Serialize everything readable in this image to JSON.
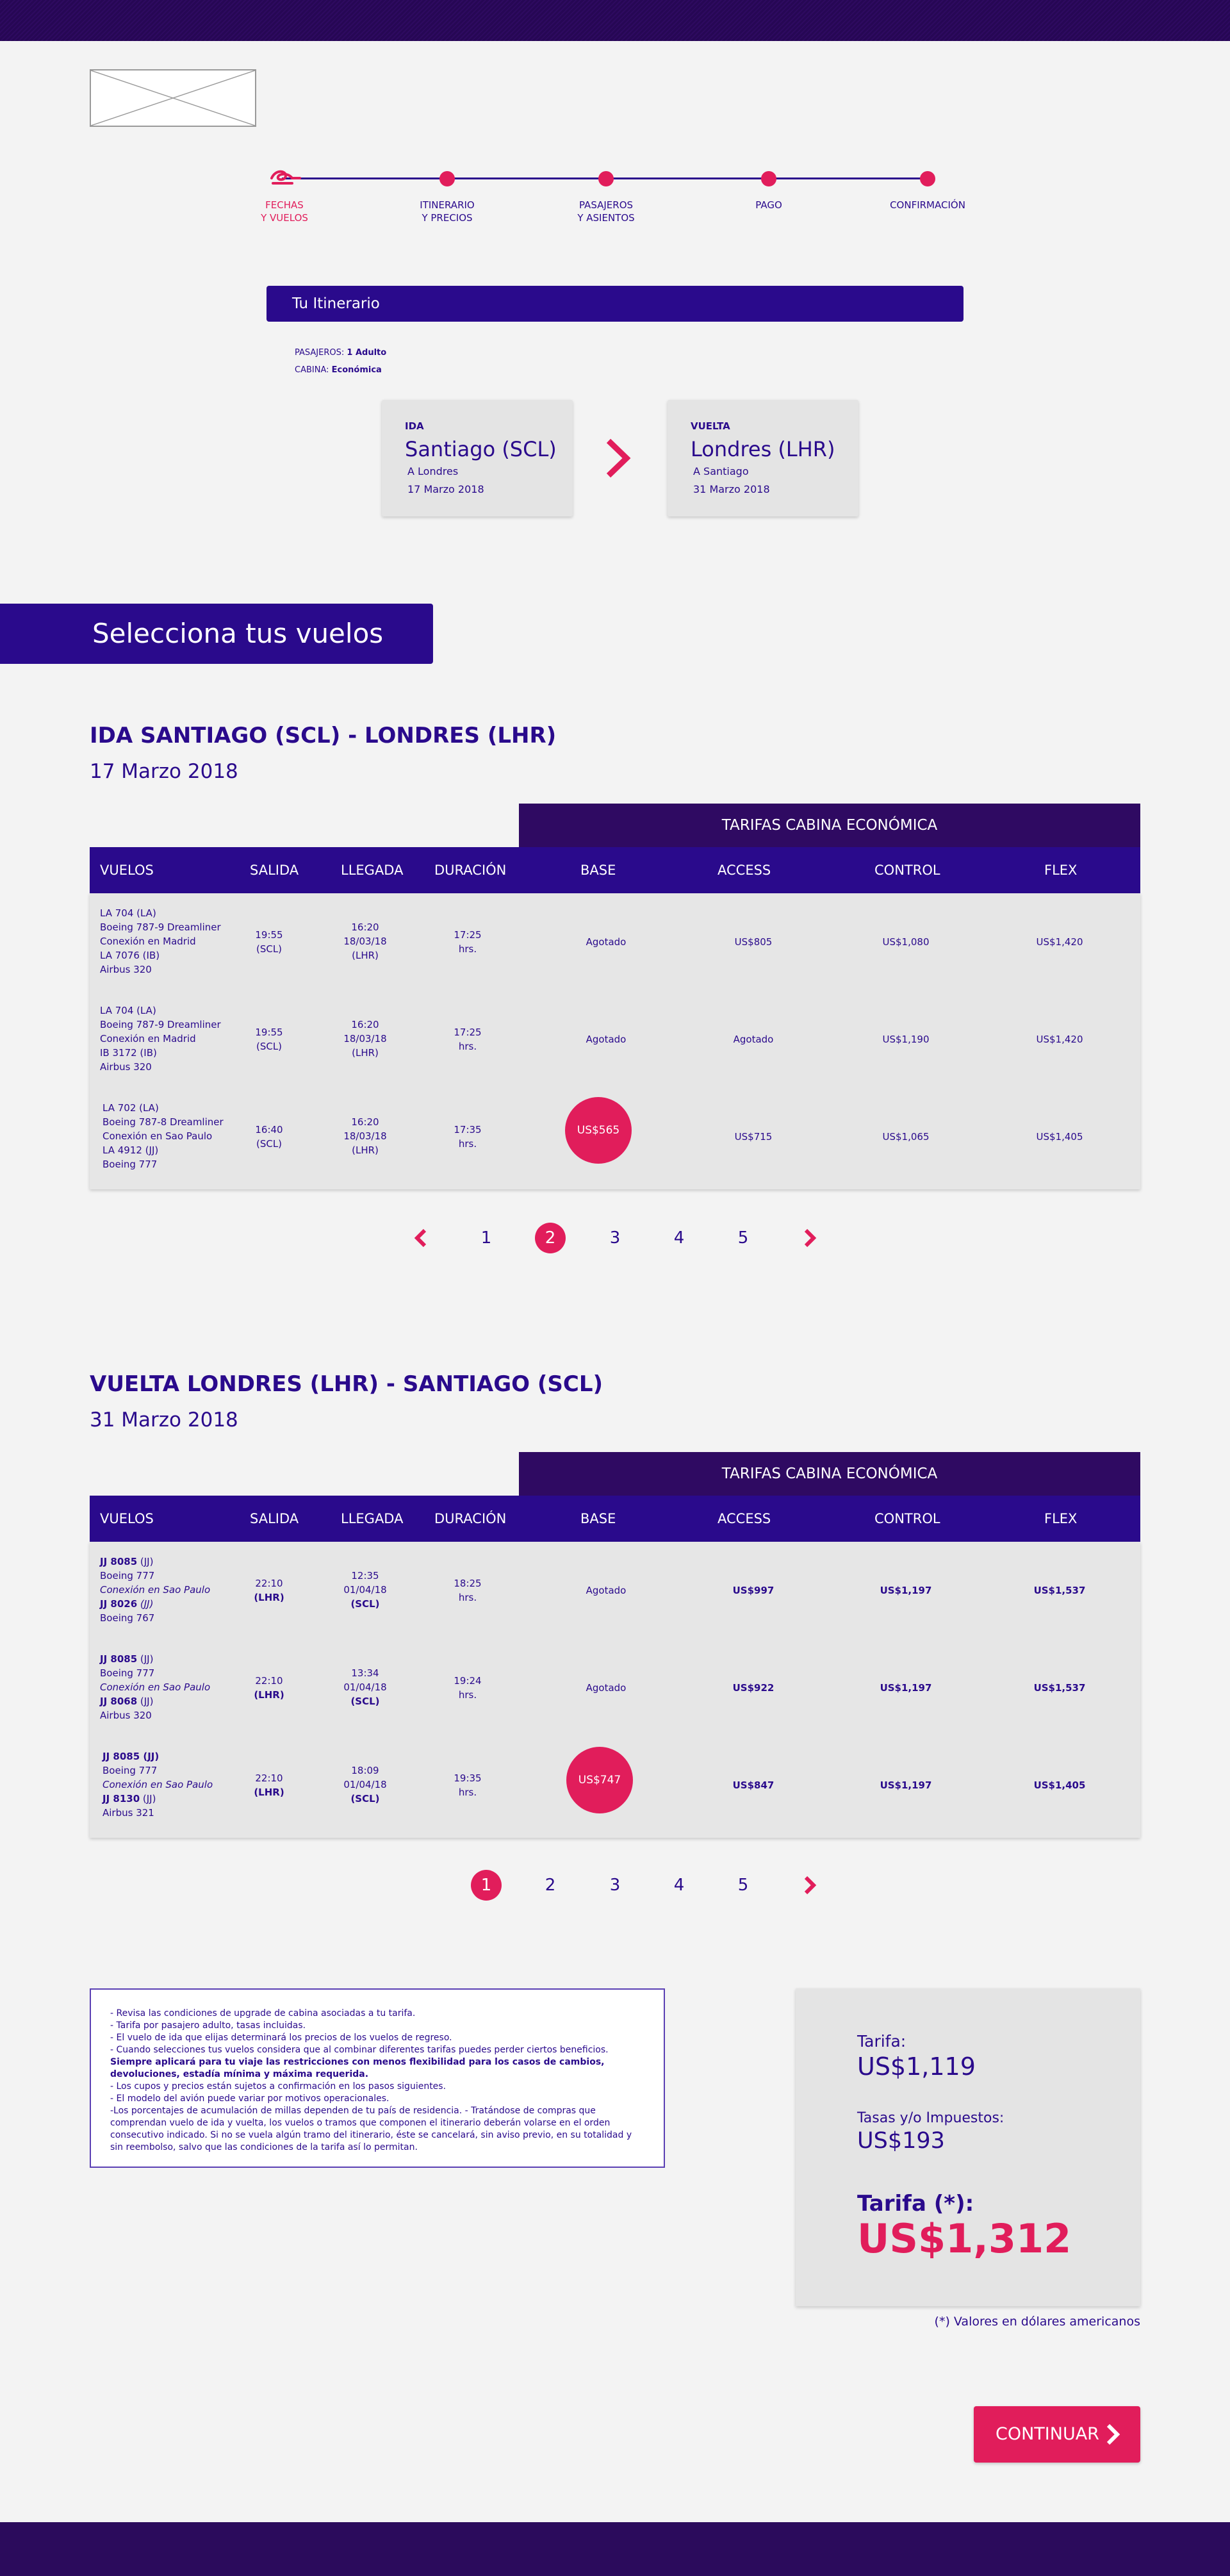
{
  "stepper": {
    "steps": [
      {
        "label": "FECHAS\nY VUELOS"
      },
      {
        "label": "ITINERARIO\nY PRECIOS"
      },
      {
        "label": "PASAJEROS\nY ASIENTOS"
      },
      {
        "label": "PAGO"
      },
      {
        "label": "CONFIRMACIÓN"
      }
    ],
    "active_color": "#e11d5b"
  },
  "itinerary": {
    "title": "Tu Itinerario",
    "passengers_label": "PASAJEROS:",
    "passengers_value": "1 Adulto",
    "cabin_label": "CABINA:",
    "cabin_value": "Económica",
    "outbound": {
      "label": "IDA",
      "city": "Santiago (SCL)",
      "destination": "A Londres",
      "date": "17 Marzo 2018"
    },
    "return": {
      "label": "VUELTA",
      "city": "Londres (LHR)",
      "destination": "A Santiago",
      "date": "31 Marzo 2018"
    }
  },
  "select_banner": "Selecciona tus vuelos",
  "outbound_section": {
    "title": "IDA SANTIAGO (SCL) - LONDRES (LHR)",
    "date": "17 Marzo 2018",
    "tarifas_header": "TARIFAS CABINA ECONÓMICA",
    "columns": [
      "VUELOS",
      "SALIDA",
      "LLEGADA",
      "DURACIÓN",
      "BASE",
      "ACCESS",
      "CONTROL",
      "FLEX"
    ],
    "rows": [
      {
        "flight": [
          "LA 704 (LA)",
          "Boeing 787-9 Dreamliner",
          "Conexión en Madrid",
          "LA 7076 (IB)",
          "Airbus 320"
        ],
        "salida": [
          "19:55",
          "(SCL)"
        ],
        "llegada": [
          "16:20",
          "18/03/18",
          "(LHR)"
        ],
        "duracion": [
          "17:25",
          "hrs."
        ],
        "base": "Agotado",
        "access": "US$805",
        "control": "US$1,080",
        "flex": "US$1,420",
        "base_selected": false
      },
      {
        "flight": [
          "LA 704 (LA)",
          "Boeing 787-9 Dreamliner",
          "Conexión en Madrid",
          "IB 3172 (IB)",
          "Airbus 320"
        ],
        "salida": [
          "19:55",
          "(SCL)"
        ],
        "llegada": [
          "16:20",
          "18/03/18",
          "(LHR)"
        ],
        "duracion": [
          "17:25",
          "hrs."
        ],
        "base": "Agotado",
        "access": "Agotado",
        "control": "US$1,190",
        "flex": "US$1,420",
        "base_selected": false
      },
      {
        "flight": [
          "LA 702 (LA)",
          "Boeing 787-8 Dreamliner",
          "Conexión en Sao Paulo",
          "LA 4912 (JJ)",
          "Boeing 777"
        ],
        "salida": [
          "16:40",
          "(SCL)"
        ],
        "llegada": [
          "16:20",
          "18/03/18",
          "(LHR)"
        ],
        "duracion": [
          "17:35",
          "hrs."
        ],
        "base": "US$565",
        "access": "US$715",
        "control": "US$1,065",
        "flex": "US$1,405",
        "base_selected": true
      }
    ],
    "pagination": {
      "pages": [
        "1",
        "2",
        "3",
        "4",
        "5"
      ],
      "current": "2"
    }
  },
  "return_section": {
    "title": "VUELTA LONDRES (LHR) - SANTIAGO (SCL)",
    "date": "31 Marzo 2018",
    "tarifas_header": "TARIFAS CABINA ECONÓMICA",
    "columns": [
      "VUELOS",
      "SALIDA",
      "LLEGADA",
      "DURACIÓN",
      "BASE",
      "ACCESS",
      "CONTROL",
      "FLEX"
    ],
    "rows": [
      {
        "flight_no1": "JJ 8085",
        "carrier1": " (JJ)",
        "aircraft1": "Boeing 777",
        "connection": "Conexión en Sao Paulo",
        "flight_no2": "JJ 8026",
        "carrier2": " (JJ)",
        "aircraft2": "Boeing 767",
        "salida": [
          "22:10",
          "(LHR)"
        ],
        "llegada": [
          "12:35",
          "01/04/18",
          "(SCL)"
        ],
        "duracion": [
          "18:25",
          "hrs."
        ],
        "base": "Agotado",
        "access": "US$997",
        "control": "US$1,197",
        "flex": "US$1,537",
        "base_selected": false
      },
      {
        "flight_no1": "JJ 8085",
        "carrier1": " (JJ)",
        "aircraft1": "Boeing 777",
        "connection": "Conexión en Sao Paulo",
        "flight_no2": "JJ 8068",
        "carrier2": " (JJ)",
        "aircraft2": "Airbus 320",
        "salida": [
          "22:10",
          "(LHR)"
        ],
        "llegada": [
          "13:34",
          "01/04/18",
          "(SCL)"
        ],
        "duracion": [
          "19:24",
          "hrs."
        ],
        "base": "Agotado",
        "access": "US$922",
        "control": "US$1,197",
        "flex": "US$1,537",
        "base_selected": false
      },
      {
        "flight_no1": "JJ 8085 (JJ)",
        "carrier1": "",
        "aircraft1": "Boeing 777",
        "connection": "Conexión en Sao Paulo",
        "flight_no2": "JJ 8130",
        "carrier2": " (JJ)",
        "aircraft2": "Airbus 321",
        "salida": [
          "22:10",
          "(LHR)"
        ],
        "llegada": [
          "18:09",
          "01/04/18",
          "(SCL)"
        ],
        "duracion": [
          "19:35",
          "hrs."
        ],
        "base": "US$747",
        "access": "US$847",
        "control": "US$1,197",
        "flex": "US$1,405",
        "base_selected": true
      }
    ],
    "pagination": {
      "pages": [
        "1",
        "2",
        "3",
        "4",
        "5"
      ],
      "current": "1"
    }
  },
  "notes": [
    {
      "text": "- Revisa las condiciones de upgrade de cabina asociadas a tu tarifa.",
      "bold": false
    },
    {
      "text": "- Tarifa por pasajero adulto, tasas incluidas.",
      "bold": false
    },
    {
      "text": "- El vuelo de ida que elijas determinará los precios de los vuelos de regreso.",
      "bold": false
    },
    {
      "text": "- Cuando selecciones tus vuelos considera que al combinar diferentes tarifas puedes perder ciertos beneficios.",
      "bold": false
    },
    {
      "text": "Siempre aplicará para tu viaje las restricciones con menos flexibilidad para los casos de cambios, devoluciones, estadía mínima y máxima requerida.",
      "bold": true
    },
    {
      "text": " - Los cupos y precios están sujetos a confirmación en los pasos siguientes.",
      "bold": false
    },
    {
      "text": "- El modelo del avión puede variar por motivos operacionales.",
      "bold": false
    },
    {
      "text": "-Los porcentajes de acumulación de millas dependen de tu país de residencia. - Tratándose de compras que comprendan vuelo de ida y vuelta, los vuelos o tramos que componen el itinerario deberán volarse en el orden consecutivo indicado. Si no se vuela algún tramo del itinerario, éste se cancelará, sin aviso previo, en su totalidad y sin reembolso, salvo que las condiciones de la tarifa así lo permitan.",
      "bold": false
    }
  ],
  "fare": {
    "tarifa_label": "Tarifa:",
    "tarifa_value": "US$1,119",
    "tasas_label": "Tasas y/o Impuestos:",
    "tasas_value": "US$193",
    "total_label": "Tarifa (*):",
    "total_value": "US$1,312",
    "disclaimer": "(*) Valores en dólares americanos"
  },
  "continue_button": "CONTINUAR",
  "colors": {
    "primary": "#2a0a8c",
    "accent": "#e11d5b",
    "dark": "#2f0a62",
    "background": "#f3f3f3"
  }
}
